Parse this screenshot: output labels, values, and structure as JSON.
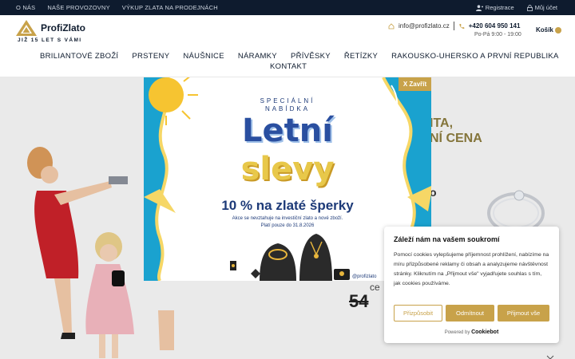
{
  "topbar": {
    "links": [
      "O NÁS",
      "NAŠE PROVOZOVNY",
      "VÝKUP ZLATA NA PRODEJNÁCH"
    ],
    "register": "Registrace",
    "account": "Můj účet"
  },
  "header": {
    "brand": "ProfiZlato",
    "tagline": "JIŽ 15 LET S VÁMI",
    "email": "info@profizlato.cz",
    "phone": "+420 604 950 141",
    "hours": "Po-Pá 9:00 - 19:00",
    "cart": "Košík"
  },
  "nav": {
    "items": [
      "BRILIANTOVÉ ZBOŽÍ",
      "PRSTENY",
      "NÁUŠNICE",
      "NÁRAMKY",
      "PŘÍVĚSKY",
      "ŘETÍZKY",
      "RAKOUSKO-UHERSKO A PRVNÍ REPUBLIKA"
    ],
    "last": "KONTAKT"
  },
  "hero": {
    "title_line1": "ITA,",
    "title_line2": "NÍ CENA",
    "line3": "o",
    "price_prefix": "ce",
    "old_price": "54"
  },
  "modal": {
    "close": "X Zavřít",
    "subtitle_line1": "SPECIÁLNÍ",
    "subtitle_line2": "NABÍDKA",
    "title_line1": "Letní",
    "title_line2": "slevy",
    "offer": "10 % na zlaté šperky",
    "note1": "Akce se nevztahuje na investiční zlato a nové zboží.",
    "note2": "Platí pouze do 31.8.2026",
    "handle": "@profizlato"
  },
  "cookie": {
    "title": "Záleží nám na vašem soukromí",
    "text": "Pomocí cookies vylepšujeme příjemnost prohlížení, nabízíme na míru přizpůsobené reklamy či obsah a analyzujeme návštěvnost stránky. Kliknutím na „Přijmout vše\" vyjadřujete souhlas s tím, jak cookies používáme.",
    "customize": "Přizpůsobit",
    "deny": "Odmítnout",
    "accept": "Přijmout vše",
    "powered_by": "Powered by",
    "powered_brand": "Cookiebot"
  },
  "colors": {
    "navy": "#0e1b2e",
    "gold": "#c8a24a",
    "blue": "#1d3a78"
  }
}
